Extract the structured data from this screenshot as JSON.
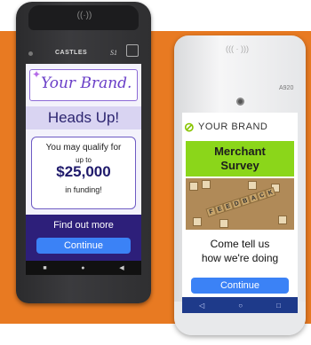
{
  "device1": {
    "brand_label": "CASTLES",
    "model_label": "S1",
    "screen": {
      "logo_text": "Your Brand.",
      "heading": "Heads Up!",
      "offer": {
        "line1": "You may qualify for",
        "line2": "up to",
        "amount": "$25,000",
        "line4": "in funding!"
      },
      "find_out": "Find out more",
      "continue_label": "Continue",
      "nav": {
        "square": "■",
        "circle": "●",
        "back": "◀"
      }
    }
  },
  "device2": {
    "model_label": "A920",
    "screen": {
      "logo_text": "YOUR BRAND",
      "survey_title_1": "Merchant",
      "survey_title_2": "Survey",
      "image_word": [
        "F",
        "E",
        "E",
        "D",
        "B",
        "A",
        "C",
        "K"
      ],
      "tagline_1": "Come tell us",
      "tagline_2": "how we're doing",
      "continue_label": "Continue",
      "nav": {
        "back": "◁",
        "home": "○",
        "recent": "□"
      }
    }
  },
  "colors": {
    "background_band": "#e87a22",
    "continue_button": "#3b82f6",
    "survey_band": "#8bd61a",
    "heading_band": "#d9d4f2"
  }
}
